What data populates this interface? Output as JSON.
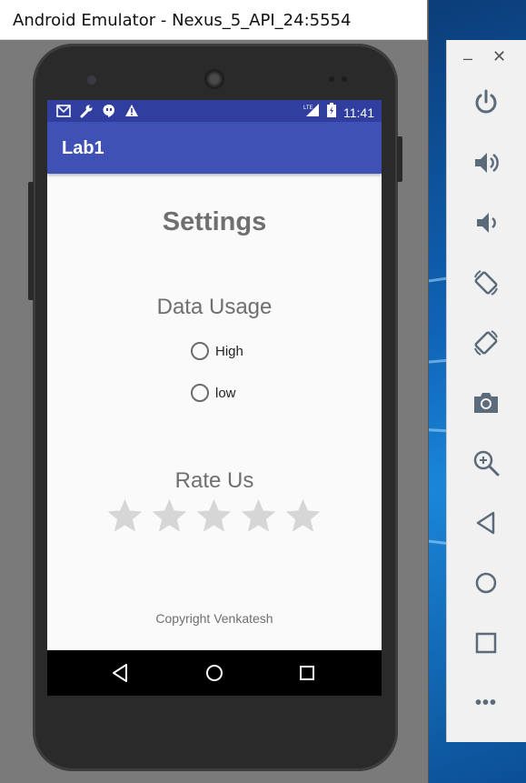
{
  "window": {
    "title": "Android Emulator - Nexus_5_API_24:5554"
  },
  "status_bar": {
    "icons": [
      "gmail-icon",
      "wrench-icon",
      "hangouts-icon",
      "warning-icon"
    ],
    "network": "LTE",
    "time": "11:41"
  },
  "app_bar": {
    "title": "Lab1"
  },
  "main": {
    "title": "Settings",
    "data_usage": {
      "label": "Data Usage",
      "options": [
        "High",
        "low"
      ]
    },
    "rate_us": {
      "label": "Rate Us",
      "max_stars": 5,
      "rating": 0
    },
    "copyright": "Copyright Venkatesh"
  },
  "nav_bar": {
    "buttons": [
      "back-icon",
      "home-icon",
      "recents-icon"
    ]
  },
  "emulator_toolbar": {
    "minimize": "–",
    "close": "✕",
    "tools": [
      "power-icon",
      "volume-up-icon",
      "volume-down-icon",
      "rotate-left-icon",
      "rotate-right-icon",
      "camera-icon",
      "zoom-icon",
      "back-icon",
      "home-icon",
      "overview-icon",
      "more-icon"
    ],
    "more_label": "•••"
  },
  "colors": {
    "primary": "#3f51b5",
    "primary_dark": "#303f9f",
    "star_empty": "#d6d6d6",
    "toolbar_icon": "#5b6b7a"
  }
}
